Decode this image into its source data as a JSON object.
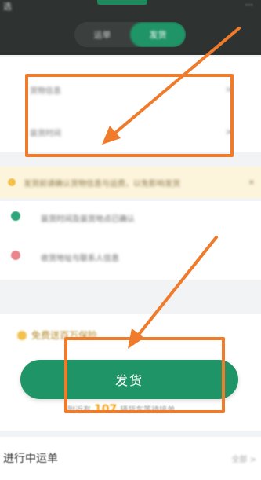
{
  "topbar": {
    "city": "选",
    "menu": "···"
  },
  "segments": [
    {
      "label": "运单"
    },
    {
      "label": "发货"
    }
  ],
  "settings": [
    {
      "label": "货物信息",
      "value": ">"
    },
    {
      "label": "装货时间",
      "value": ">"
    }
  ],
  "notice": {
    "text": "发货前请确认货物信息与运费，以免影响发货",
    "close": "×"
  },
  "list": [
    {
      "text": "装货时间及装货地点已确认"
    },
    {
      "text": "收货地址与联系人信息"
    }
  ],
  "insurance": {
    "text": "免费送百万保险"
  },
  "ship_button": {
    "label": "发货"
  },
  "distance": {
    "prefix": "附近有",
    "count": "107",
    "suffix": "辆货车等待接单"
  },
  "bottom": {
    "title": "进行中运单",
    "more": "全部 >"
  },
  "colors": {
    "primary": "#1f9466",
    "annotation": "#f07b2b",
    "accent": "#f5a623"
  }
}
